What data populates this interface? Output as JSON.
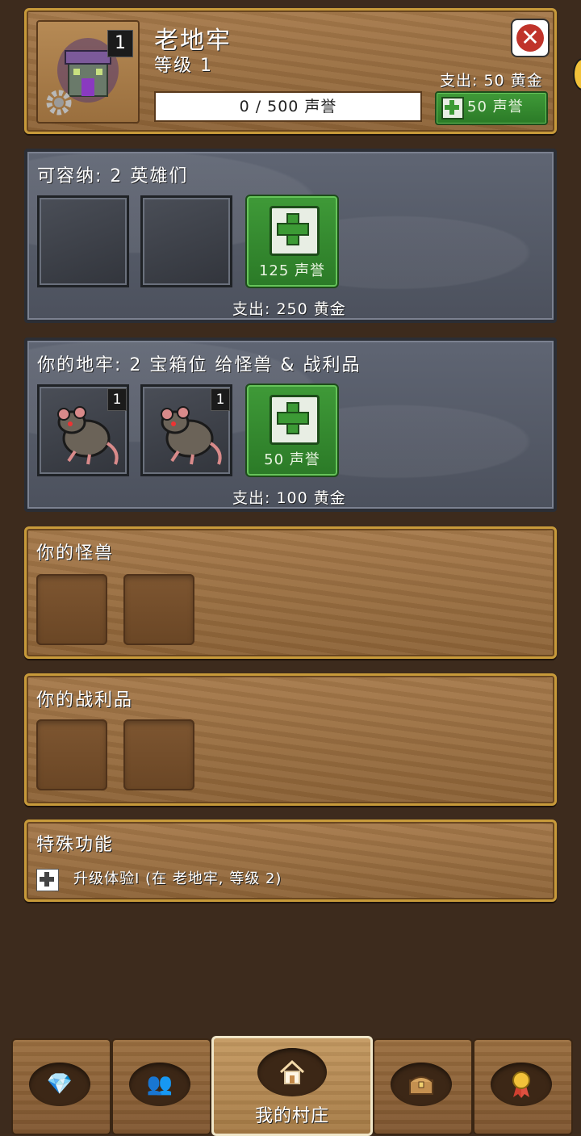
{
  "header": {
    "name": "老地牢",
    "level": "等级 1",
    "level_badge": "1",
    "progress_text": "0 / 500 声誉",
    "progress_fraction": 0,
    "cost": "支出: 50 黄金",
    "upgrade_label": "50 声誉"
  },
  "heroes": {
    "title": "可容纳: 2 英雄们",
    "add_cost": "125 声誉",
    "cost": "支出: 250 黄金"
  },
  "dungeon": {
    "title": "你的地牢: 2 宝箱位 给怪兽 & 战利品",
    "slot_badges": [
      "1",
      "1"
    ],
    "add_cost": "50 声誉",
    "cost": "支出: 100 黄金"
  },
  "monsters": {
    "title": "你的怪兽"
  },
  "loot": {
    "title": "你的战利品"
  },
  "special": {
    "title": "特殊功能",
    "item": "升级体验I (在 老地牢, 等级 2)"
  },
  "nav": {
    "active_label": "我的村庄",
    "icons": [
      "diamond-icon",
      "heroes-icon",
      "house-icon",
      "chest-icon",
      "medal-icon"
    ]
  },
  "colors": {
    "accent_green": "#2b7a27",
    "frame_gold": "#c79a3a",
    "background": "#3d2b1d"
  }
}
